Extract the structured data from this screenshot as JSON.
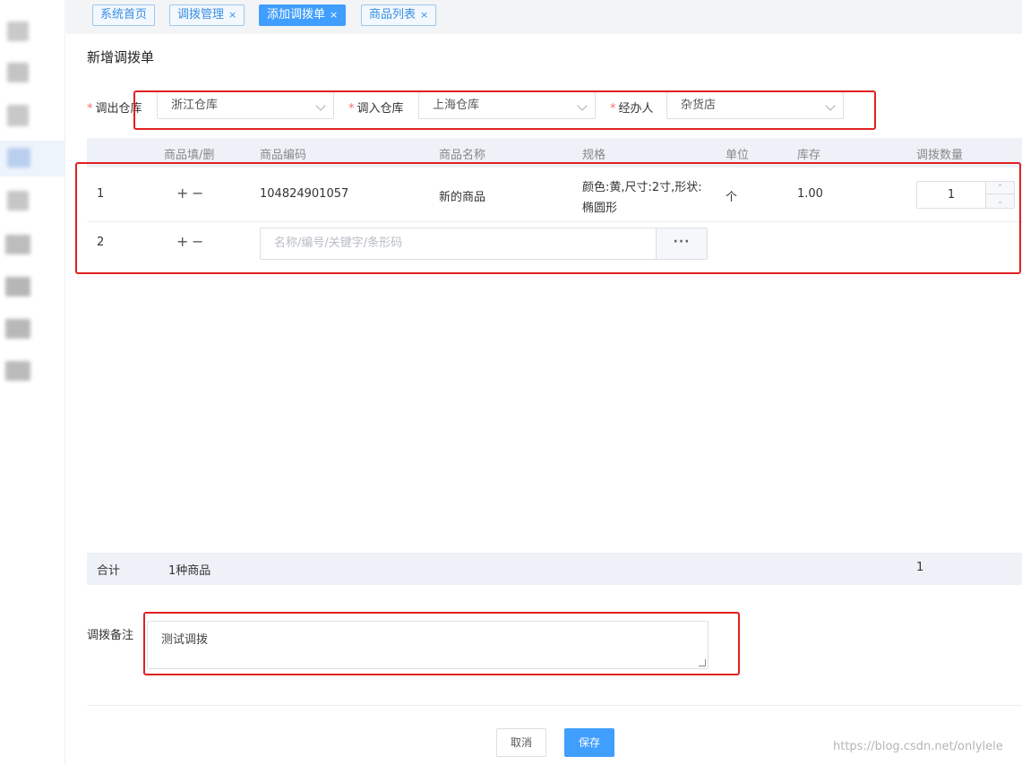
{
  "tabs": [
    {
      "label": "系统首页",
      "closable": false,
      "active": false
    },
    {
      "label": "调拨管理",
      "closable": true,
      "active": false
    },
    {
      "label": "添加调拨单",
      "closable": true,
      "active": true
    },
    {
      "label": "商品列表",
      "closable": true,
      "active": false
    }
  ],
  "close_glyph": "×",
  "page_title": "新增调拨单",
  "required_mark": "*",
  "form": {
    "out_warehouse": {
      "label": "调出仓库",
      "value": "浙江仓库"
    },
    "in_warehouse": {
      "label": "调入仓库",
      "value": "上海仓库"
    },
    "handler": {
      "label": "经办人",
      "value": "杂货店"
    }
  },
  "table": {
    "headers": [
      "商品填/删",
      "商品编码",
      "商品名称",
      "规格",
      "单位",
      "库存",
      "调拨数量"
    ],
    "rows": [
      {
        "index": "1",
        "add": "+",
        "remove": "−",
        "code": "104824901057",
        "name": "新的商品",
        "spec_line1": "颜色:黄,尺寸:2寸,形状:",
        "spec_line2": "椭圆形",
        "unit": "个",
        "stock": "1.00",
        "quantity": "1"
      },
      {
        "index": "2",
        "add": "+",
        "remove": "−",
        "search_placeholder": "名称/编号/关键字/条形码",
        "more_label": "···"
      }
    ],
    "footer": {
      "label": "合计",
      "summary": "1种商品",
      "total_quantity": "1"
    }
  },
  "remark": {
    "label": "调拨备注",
    "value": "测试调拨"
  },
  "buttons": {
    "cancel": "取消",
    "save": "保存"
  },
  "watermark": "https://blog.csdn.net/onlylele",
  "colors": {
    "primary": "#409eff",
    "required": "#f56c6c",
    "highlight_box": "#e02020"
  }
}
